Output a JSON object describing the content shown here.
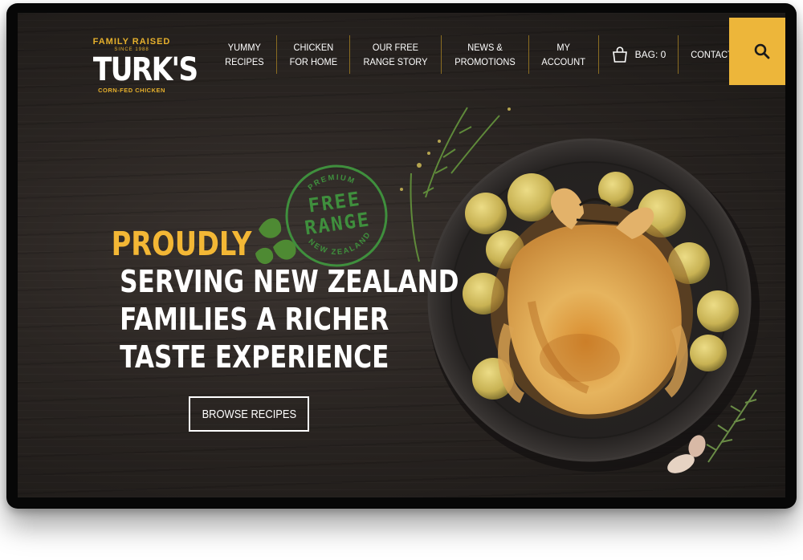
{
  "brand": {
    "top_line": "FAMILY RAISED",
    "since": "SINCE 1988",
    "name": "TURK'S",
    "bottom_line": "CORN-FED CHICKEN"
  },
  "nav": {
    "items": [
      {
        "line1": "YUMMY",
        "line2": "RECIPES"
      },
      {
        "line1": "CHICKEN",
        "line2": "FOR HOME"
      },
      {
        "line1": "OUR FREE",
        "line2": "RANGE STORY"
      },
      {
        "line1": "NEWS &",
        "line2": "PROMOTIONS"
      },
      {
        "line1": "MY",
        "line2": "ACCOUNT"
      }
    ],
    "bag_label": "BAG: 0",
    "contact_label": "CONTACT",
    "search_icon": "search-icon"
  },
  "stamp": {
    "top": "PREMIUM",
    "word1": "FREE",
    "word2": "RANGE",
    "bottom": "NEW ZEALAND"
  },
  "hero": {
    "highlight": "PROUDLY",
    "line1": "SERVING NEW ZEALAND",
    "line2": "FAMILIES A RICHER",
    "line3": "TASTE EXPERIENCE",
    "cta_label": "BROWSE RECIPES"
  },
  "colors": {
    "accent": "#edb63a",
    "stamp_green": "#3f8f3d",
    "background": "#2a2522",
    "text": "#ffffff"
  }
}
